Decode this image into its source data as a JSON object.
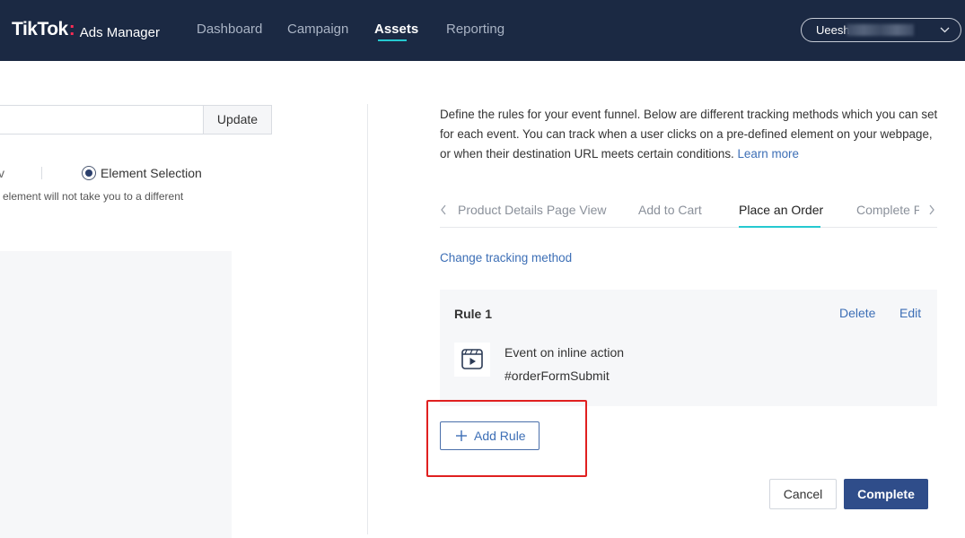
{
  "app": {
    "logo_main": "TikTok",
    "logo_dot": ":",
    "logo_sub": "Ads Manager"
  },
  "nav": {
    "items": [
      {
        "label": "Dashboard",
        "active": false
      },
      {
        "label": "Campaign",
        "active": false
      },
      {
        "label": "Assets",
        "active": true
      },
      {
        "label": "Reporting",
        "active": false
      }
    ],
    "accent_color": "#25c9d0"
  },
  "account": {
    "name": "Ueesh",
    "chevron_icon": "chevron-down-icon"
  },
  "left_panel": {
    "url_input_value": "",
    "update_label": "Update",
    "option_fragment": "v",
    "radio_label": "Element Selection",
    "radio_selected": true,
    "help_text": "element will not take you to a different"
  },
  "right_panel": {
    "description": "Define the rules for your event funnel. Below are different tracking methods which you can set for each event. You can track when a user clicks on a pre-defined element on your webpage, or when their destination URL meets certain conditions.",
    "learn_more": "Learn more",
    "tabs": [
      {
        "label": "Product Details Page View",
        "active": false
      },
      {
        "label": "Add to Cart",
        "active": false
      },
      {
        "label": "Place an Order",
        "active": true
      },
      {
        "label": "Complete Payment",
        "active": false
      }
    ],
    "prev_icon": "chevron-left-icon",
    "next_icon": "chevron-right-icon",
    "change_method_label": "Change tracking method",
    "rule": {
      "title": "Rule 1",
      "delete_label": "Delete",
      "edit_label": "Edit",
      "icon": "video-play-icon",
      "event_label": "Event on inline action",
      "selector": "#orderFormSubmit"
    },
    "add_rule_label": "Add Rule",
    "add_rule_icon": "plus-icon"
  },
  "footer": {
    "cancel_label": "Cancel",
    "complete_label": "Complete",
    "primary_color": "#2f4d8a"
  }
}
